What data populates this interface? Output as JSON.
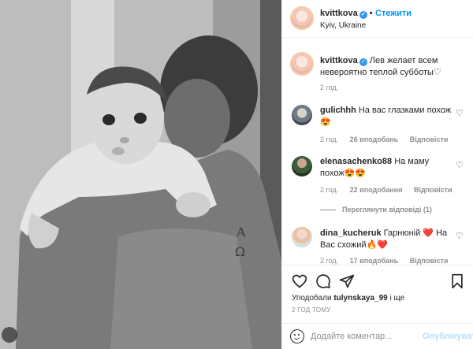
{
  "post": {
    "image_icon": "photo-baby-on-shoulder",
    "corner_icon": "more-dots-icon"
  },
  "header": {
    "username": "kvittkova",
    "separator": "•",
    "follow_label": "Стежити",
    "location": "Kyiv, Ukraine",
    "verified_icon": "verified-badge-icon"
  },
  "caption": {
    "username": "kvittkova",
    "text": "Лев желает всем невероятно теплой субботы♡",
    "time": "2 год."
  },
  "comments": [
    {
      "username": "gulichhh",
      "text": "На вас глазками похож 😍",
      "time": "2 год.",
      "likes": "26 вподобань",
      "reply": "Відповісти"
    },
    {
      "username": "elenasachenko88",
      "text": "На маму похож😍😍",
      "time": "2 год.",
      "likes": "22 вподобання",
      "reply": "Відповісти"
    },
    {
      "username": "dina_kucheruk",
      "text": "Гарнюній ❤️ На Вас схожий🔥❤️",
      "time": "2 год.",
      "likes": "17 вподобань",
      "reply": "Відповісти"
    }
  ],
  "view_replies": "Переглянути відповіді (1)",
  "actions": {
    "like_icon": "heart-icon",
    "comment_icon": "comment-icon",
    "share_icon": "share-icon",
    "save_icon": "bookmark-icon"
  },
  "likes": {
    "prefix": "Уподобали",
    "user": "tulynskaya_99",
    "suffix": "і ще"
  },
  "post_time": "2 ГОД ТОМУ",
  "comment_box": {
    "placeholder": "Додайте коментар...",
    "publish_label": "Опублікувати"
  },
  "colors": {
    "accent": "#0095f6",
    "verified": "#3897f0",
    "muted": "#8e8e8e",
    "border": "#efefef"
  }
}
